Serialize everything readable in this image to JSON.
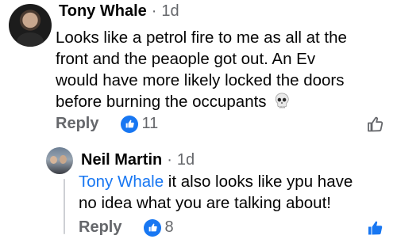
{
  "comments": [
    {
      "author": "Tony Whale",
      "separator": "·",
      "time": "1d",
      "lines": [
        "Looks like a petrol fire to me as all at the",
        "front and the peaople got out. An Ev",
        "would have more likely locked the doors",
        "before burning the occupants"
      ],
      "emoji": "skull-icon",
      "reply_label": "Reply",
      "reaction_count": "11",
      "like_state": "not-liked"
    },
    {
      "author": "Neil Martin",
      "separator": "·",
      "time": "1d",
      "mention": "Tony Whale",
      "text_line1_rest": " it also looks like ypu have",
      "text_line2": "no idea what you are talking about!",
      "reply_label": "Reply",
      "reaction_count": "8",
      "like_state": "liked"
    }
  ],
  "colors": {
    "accent": "#1877f2",
    "secondary_text": "#65676b",
    "thread_line": "#ced0d4"
  }
}
